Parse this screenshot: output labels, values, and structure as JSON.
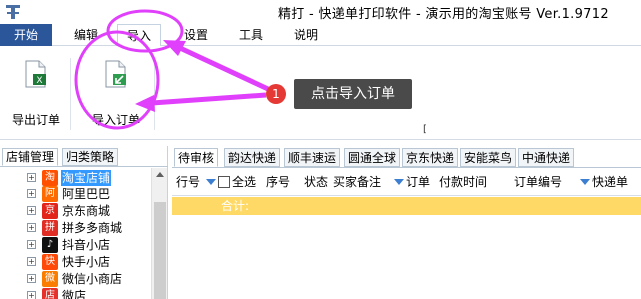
{
  "window": {
    "title": "精打 - 快递单打印软件 - 演示用的淘宝账号 Ver.1.9712"
  },
  "menu": {
    "items": [
      {
        "label": "开始"
      },
      {
        "label": "编辑"
      },
      {
        "label": "导入"
      },
      {
        "label": "设置"
      },
      {
        "label": "工具"
      },
      {
        "label": "说明"
      }
    ]
  },
  "ribbon": {
    "export_label": "导出订单",
    "import_label": "导入订单",
    "cursor_text": "["
  },
  "annotation": {
    "number": "1",
    "text": "点击导入订单",
    "color": "#e040fb"
  },
  "left_panel": {
    "tabs": [
      {
        "label": "店铺管理"
      },
      {
        "label": "归类策略"
      }
    ],
    "shops": [
      {
        "label": "淘宝店铺",
        "icon": "taobao-icon",
        "glyph": "淘",
        "color": "#ff5000"
      },
      {
        "label": "阿里巴巴",
        "icon": "alibaba-icon",
        "glyph": "阿",
        "color": "#ff6a00"
      },
      {
        "label": "京东商城",
        "icon": "jd-icon",
        "glyph": "京",
        "color": "#e1251b"
      },
      {
        "label": "拼多多商城",
        "icon": "pinduoduo-icon",
        "glyph": "拼",
        "color": "#e02e24"
      },
      {
        "label": "抖音小店",
        "icon": "douyin-icon",
        "glyph": "♪",
        "color": "#111111"
      },
      {
        "label": "快手小店",
        "icon": "kuaishou-icon",
        "glyph": "快",
        "color": "#ff4906"
      },
      {
        "label": "微信小商店",
        "icon": "wechat-shop-icon",
        "glyph": "微",
        "color": "#fa7d00"
      },
      {
        "label": "微店",
        "icon": "weidian-icon",
        "glyph": "店",
        "color": "#e5312a"
      }
    ]
  },
  "right_panel": {
    "tabs": [
      {
        "label": "待审核"
      },
      {
        "label": "韵达快递"
      },
      {
        "label": "顺丰速运"
      },
      {
        "label": "圆通全球"
      },
      {
        "label": "京东快递"
      },
      {
        "label": "安能菜鸟"
      },
      {
        "label": "中通快递"
      }
    ],
    "columns": [
      {
        "label": "行号",
        "filter": false,
        "checkbox": false
      },
      {
        "label": "全选",
        "filter": true,
        "checkbox": true
      },
      {
        "label": "序号",
        "filter": false,
        "checkbox": false
      },
      {
        "label": "状态",
        "filter": false,
        "checkbox": false
      },
      {
        "label": "买家备注",
        "filter": false,
        "checkbox": false
      },
      {
        "label": "订单",
        "filter": true,
        "checkbox": false
      },
      {
        "label": "付款时间",
        "filter": false,
        "checkbox": false
      },
      {
        "label": "订单编号",
        "filter": false,
        "checkbox": false
      },
      {
        "label": "快递单",
        "filter": true,
        "checkbox": false
      }
    ],
    "total_label": "合计:"
  }
}
